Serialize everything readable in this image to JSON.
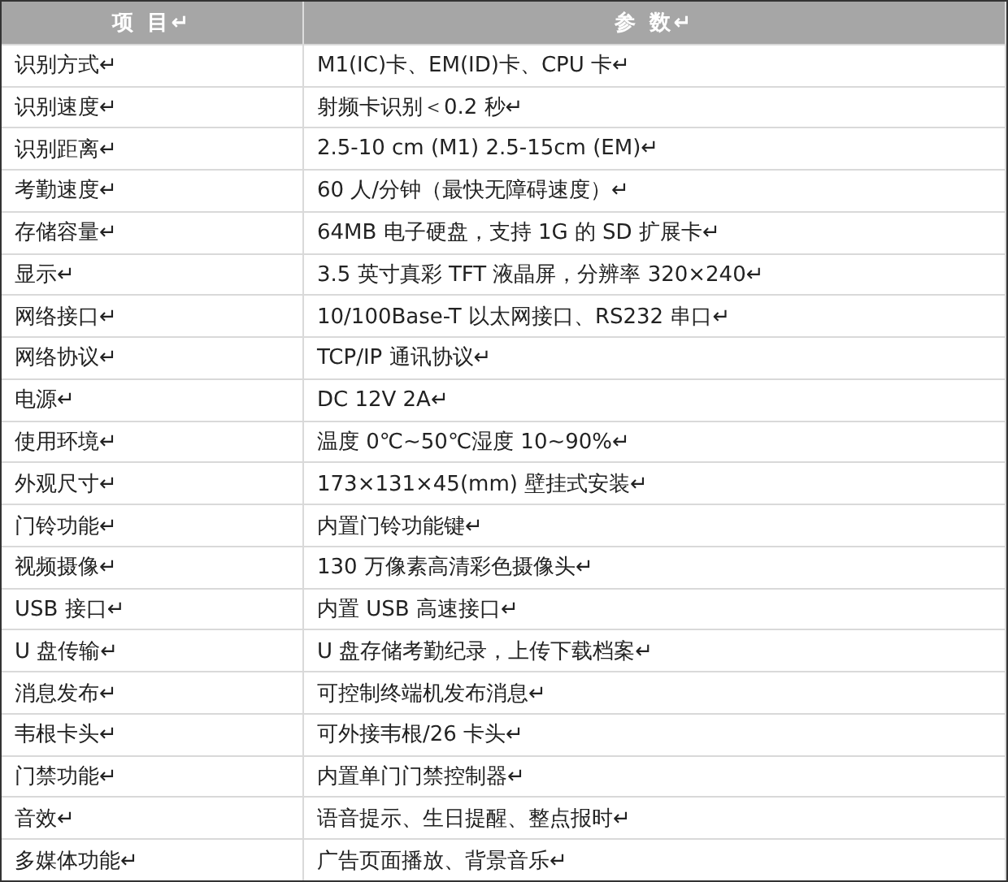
{
  "table": {
    "columns": [
      "项 目↵",
      "参 数↵"
    ],
    "rows": [
      [
        "识别方式↵",
        "M1(IC)卡、EM(ID)卡、CPU 卡↵"
      ],
      [
        "识别速度↵",
        "射频卡识别＜0.2 秒↵"
      ],
      [
        "识别距离↵",
        "2.5-10 cm (M1) 2.5-15cm (EM)↵"
      ],
      [
        "考勤速度↵",
        "60 人/分钟（最快无障碍速度）↵"
      ],
      [
        "存储容量↵",
        "64MB 电子硬盘，支持 1G 的 SD 扩展卡↵"
      ],
      [
        "显示↵",
        "3.5 英寸真彩 TFT 液晶屏，分辨率 320×240↵"
      ],
      [
        "网络接口↵",
        "10/100Base-T 以太网接口、RS232 串口↵"
      ],
      [
        "网络协议↵",
        "TCP/IP 通讯协议↵"
      ],
      [
        "电源↵",
        "DC 12V 2A↵"
      ],
      [
        "使用环境↵",
        "温度 0℃~50℃湿度 10~90%↵"
      ],
      [
        "外观尺寸↵",
        "173×131×45(mm) 壁挂式安装↵"
      ],
      [
        "门铃功能↵",
        "内置门铃功能键↵"
      ],
      [
        "视频摄像↵",
        "130 万像素高清彩色摄像头↵"
      ],
      [
        "USB 接口↵",
        "内置 USB 高速接口↵"
      ],
      [
        "U 盘传输↵",
        "U 盘存储考勤纪录，上传下载档案↵"
      ],
      [
        "消息发布↵",
        "可控制终端机发布消息↵"
      ],
      [
        "韦根卡头↵",
        "可外接韦根/26 卡头↵"
      ],
      [
        "门禁功能↵",
        "内置单门门禁控制器↵"
      ],
      [
        "音效↵",
        "语音提示、生日提醒、整点报时↵"
      ],
      [
        "多媒体功能↵",
        "广告页面播放、背景音乐↵"
      ]
    ]
  }
}
